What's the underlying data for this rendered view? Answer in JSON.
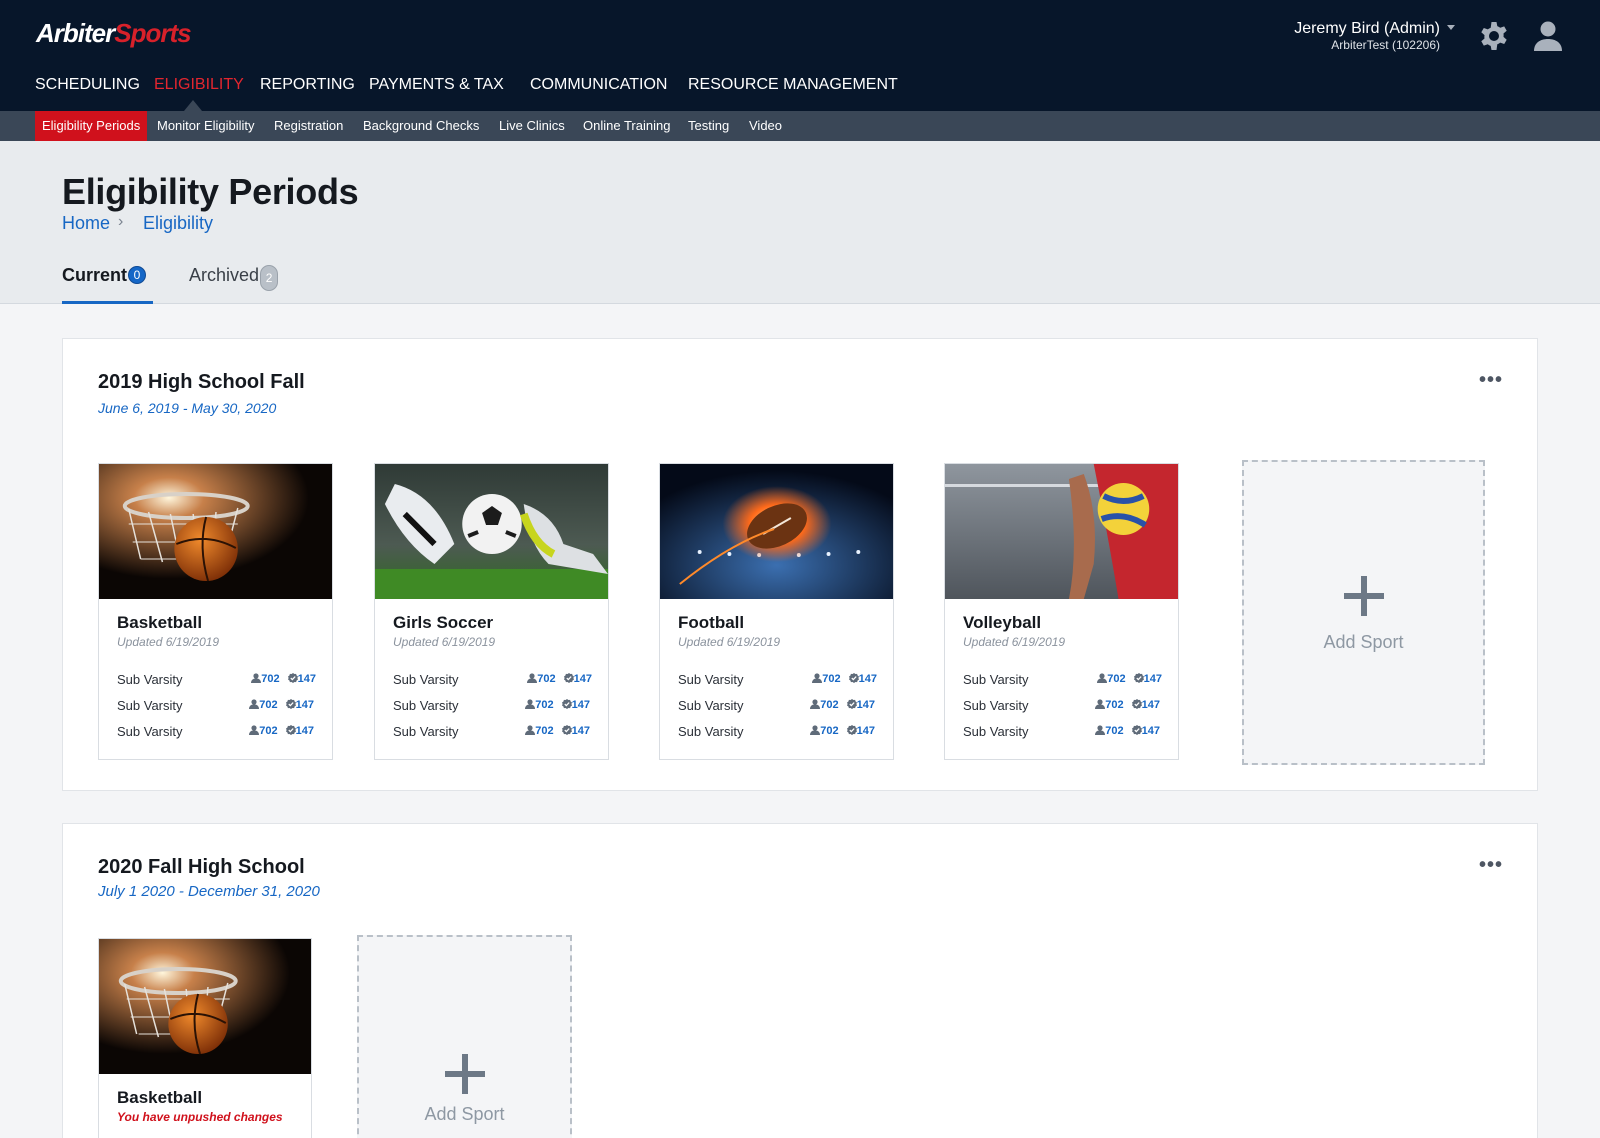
{
  "header": {
    "logo_part1": "Arbiter",
    "logo_part2": "Sports",
    "user_name": "Jeremy Bird (Admin)",
    "user_org": "ArbiterTest (102206)",
    "colors": {
      "header_bg": "#07162a",
      "accent_red": "#d0111c",
      "link_blue": "#1767c4"
    }
  },
  "main_nav": [
    {
      "label": "SCHEDULING"
    },
    {
      "label": "ELIGIBILITY",
      "active": true
    },
    {
      "label": "REPORTING"
    },
    {
      "label": "PAYMENTS & TAX"
    },
    {
      "label": "COMMUNICATION"
    },
    {
      "label": "RESOURCE MANAGEMENT"
    }
  ],
  "sub_nav": [
    {
      "label": "Eligibility Periods",
      "active": true
    },
    {
      "label": "Monitor Eligibility"
    },
    {
      "label": "Registration"
    },
    {
      "label": "Background Checks"
    },
    {
      "label": "Live Clinics"
    },
    {
      "label": "Online Training"
    },
    {
      "label": "Testing"
    },
    {
      "label": "Video"
    }
  ],
  "page": {
    "title": "Eligibility Periods",
    "breadcrumb": [
      "Home",
      "Eligibility"
    ],
    "tabs": [
      {
        "label": "Current",
        "count": "0",
        "active": true
      },
      {
        "label": "Archived",
        "count": "2"
      }
    ]
  },
  "periods": [
    {
      "title": "2019 High School Fall",
      "dates": "June 6, 2019 - May 30, 2020",
      "more": "•••",
      "sports": [
        {
          "name": "Basketball",
          "image_icon": "basketball-photo",
          "updated": "Updated 6/19/2019",
          "levels": [
            {
              "label": "Sub Varsity",
              "users": "702",
              "verified": "147"
            },
            {
              "label": "Sub Varsity",
              "users": "702",
              "verified": "147"
            },
            {
              "label": "Sub Varsity",
              "users": "702",
              "verified": "147"
            }
          ]
        },
        {
          "name": "Girls Soccer",
          "image_icon": "soccer-photo",
          "updated": "Updated 6/19/2019",
          "levels": [
            {
              "label": "Sub Varsity",
              "users": "702",
              "verified": "147"
            },
            {
              "label": "Sub Varsity",
              "users": "702",
              "verified": "147"
            },
            {
              "label": "Sub Varsity",
              "users": "702",
              "verified": "147"
            }
          ]
        },
        {
          "name": "Football",
          "image_icon": "football-photo",
          "updated": "Updated 6/19/2019",
          "levels": [
            {
              "label": "Sub Varsity",
              "users": "702",
              "verified": "147"
            },
            {
              "label": "Sub Varsity",
              "users": "702",
              "verified": "147"
            },
            {
              "label": "Sub Varsity",
              "users": "702",
              "verified": "147"
            }
          ]
        },
        {
          "name": "Volleyball",
          "image_icon": "volleyball-photo",
          "updated": "Updated 6/19/2019",
          "levels": [
            {
              "label": "Sub Varsity",
              "users": "702",
              "verified": "147"
            },
            {
              "label": "Sub Varsity",
              "users": "702",
              "verified": "147"
            },
            {
              "label": "Sub Varsity",
              "users": "702",
              "verified": "147"
            }
          ]
        }
      ],
      "add_label": "Add Sport"
    },
    {
      "title": "2020 Fall High School",
      "dates": "July 1 2020 - December 31, 2020",
      "more": "•••",
      "sports": [
        {
          "name": "Basketball",
          "image_icon": "basketball-photo",
          "warning": "You have unpushed changes"
        }
      ],
      "add_label": "Add Sport"
    }
  ]
}
